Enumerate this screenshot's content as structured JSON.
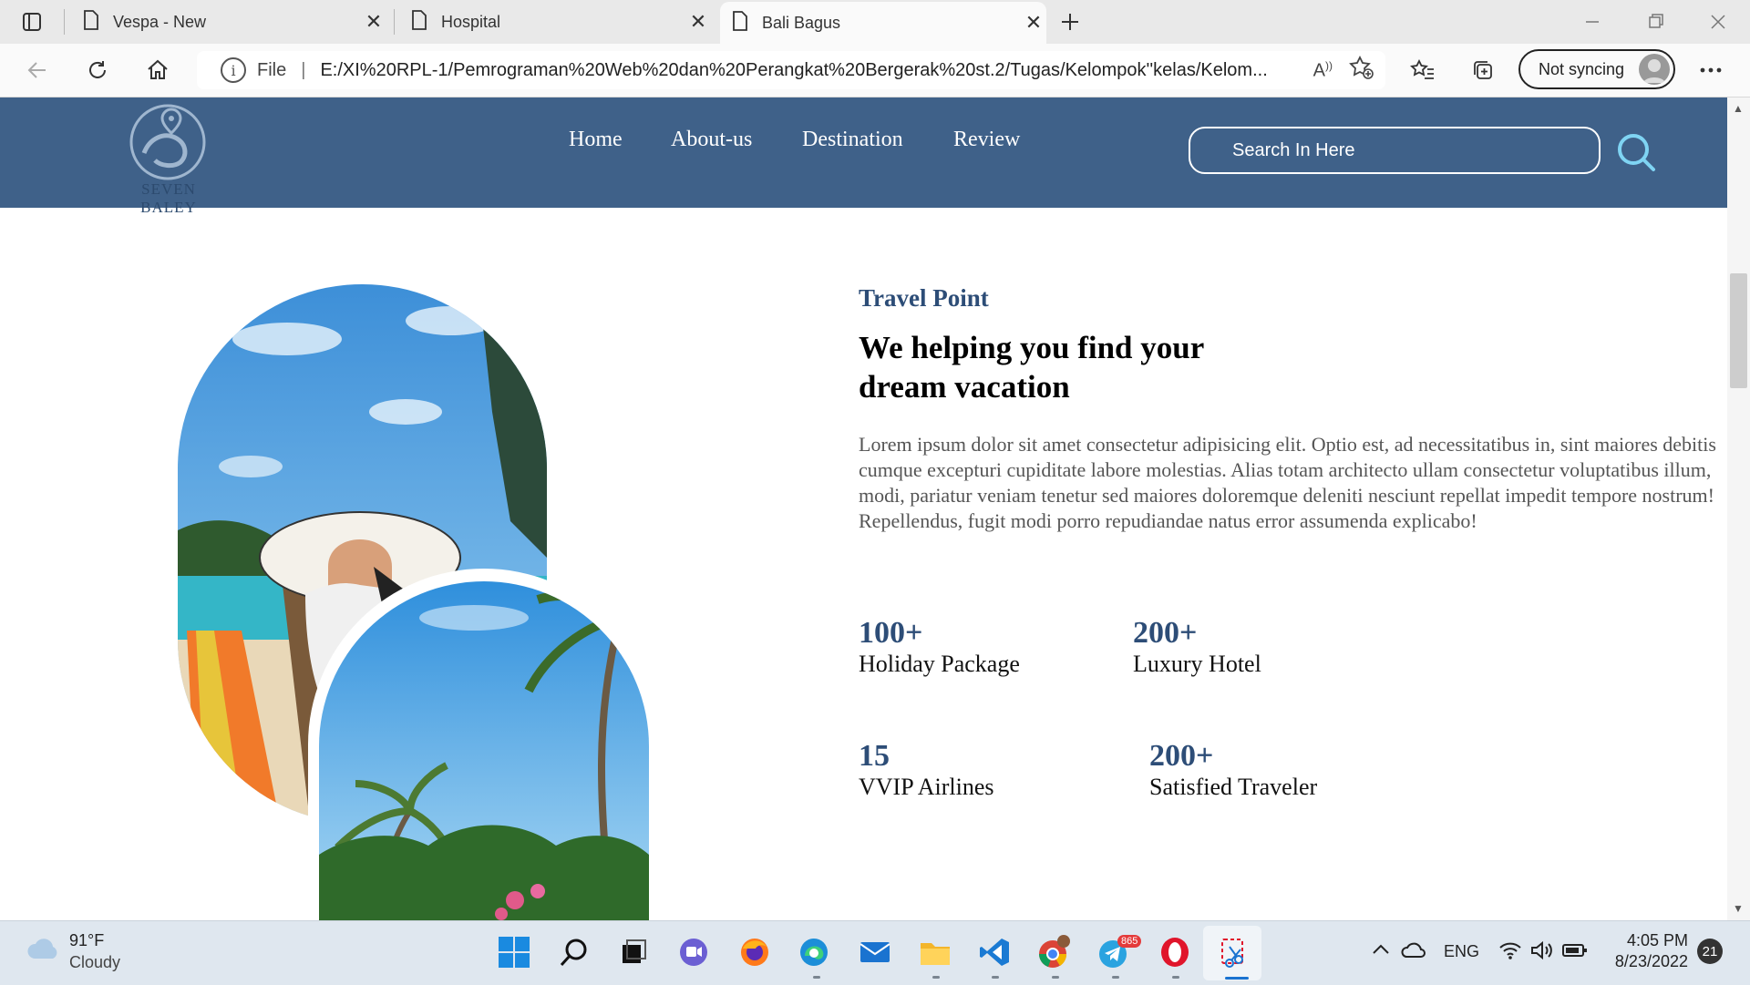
{
  "browser": {
    "tabs": [
      {
        "label": "Vespa - New"
      },
      {
        "label": "Hospital"
      },
      {
        "label": "Bali Bagus"
      }
    ],
    "address": {
      "protocol_label": "File",
      "url": "E:/XI%20RPL-1/Pemrograman%20Web%20dan%20Perangkat%20Bergerak%20st.2/Tugas/Kelompok''kelas/Kelom..."
    },
    "profile": {
      "label": "Not syncing"
    }
  },
  "site": {
    "logo_text": "SEVEN BALEY",
    "nav": [
      "Home",
      "About-us",
      "Destination",
      "Review"
    ],
    "search_placeholder": "Search In Here"
  },
  "content": {
    "eyebrow": "Travel Point",
    "headline_line1": "We helping you find your",
    "headline_line2": "dream vacation",
    "paragraph": "Lorem ipsum dolor sit amet consectetur adipisicing elit. Optio est, ad necessitatibus in, sint maiores debitis cumque excepturi cupiditate labore molestias. Alias totam architecto ullam consectetur voluptatibus illum, modi, pariatur veniam tenetur sed maiores doloremque deleniti nesciunt repellat impedit tempore nostrum! Repellendus, fugit modi porro repudiandae natus error assumenda explicabo!",
    "stats": [
      {
        "value": "100+",
        "label": "Holiday Package"
      },
      {
        "value": "200+",
        "label": "Luxury Hotel"
      },
      {
        "value": "15",
        "label": "VVIP Airlines"
      },
      {
        "value": "200+",
        "label": "Satisfied Traveler"
      }
    ]
  },
  "taskbar": {
    "weather": {
      "temp": "91°F",
      "condition": "Cloudy"
    },
    "language": "ENG",
    "time": "4:05 PM",
    "date": "8/23/2022",
    "notifications": "21",
    "telegram_badge": "865"
  },
  "colors": {
    "header_bg": "#3f6189",
    "accent": "#2d4d77"
  }
}
